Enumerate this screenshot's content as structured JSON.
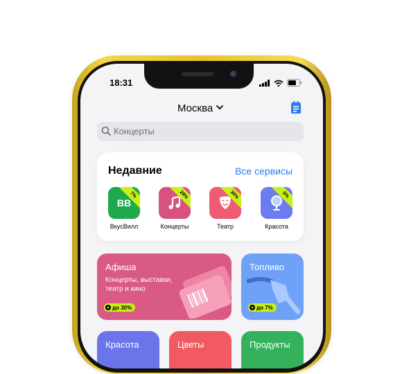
{
  "status": {
    "time": "18:31"
  },
  "header": {
    "city": "Москва"
  },
  "search": {
    "placeholder": "Концерты"
  },
  "recent": {
    "title": "Недавние",
    "all_services": "Все сервисы",
    "apps": [
      {
        "label": "ВкусВилл",
        "discount": "7%",
        "icon_text": "ВВ",
        "color": "#1fa94c"
      },
      {
        "label": "Концерты",
        "discount": "28%",
        "icon": "music-note-icon",
        "color": "#d9527f"
      },
      {
        "label": "Театр",
        "discount": "30%",
        "icon": "theater-mask-icon",
        "color": "#ec5c73"
      },
      {
        "label": "Красота",
        "discount": "5%",
        "icon": "mirror-icon",
        "color": "#6b7bf0"
      }
    ]
  },
  "tiles": {
    "afisha": {
      "title": "Афиша",
      "subtitle": "Концерты, выставки, театр и кино",
      "badge": "до 30%",
      "color": "#d95a84"
    },
    "fuel": {
      "title": "Топливо",
      "badge": "до 7%",
      "color": "#6fa2f7"
    },
    "beauty": {
      "title": "Красота",
      "color": "#6b74e8"
    },
    "flowers": {
      "title": "Цветы",
      "color": "#f05a60"
    },
    "products": {
      "title": "Продукты",
      "color": "#35b15b"
    }
  }
}
